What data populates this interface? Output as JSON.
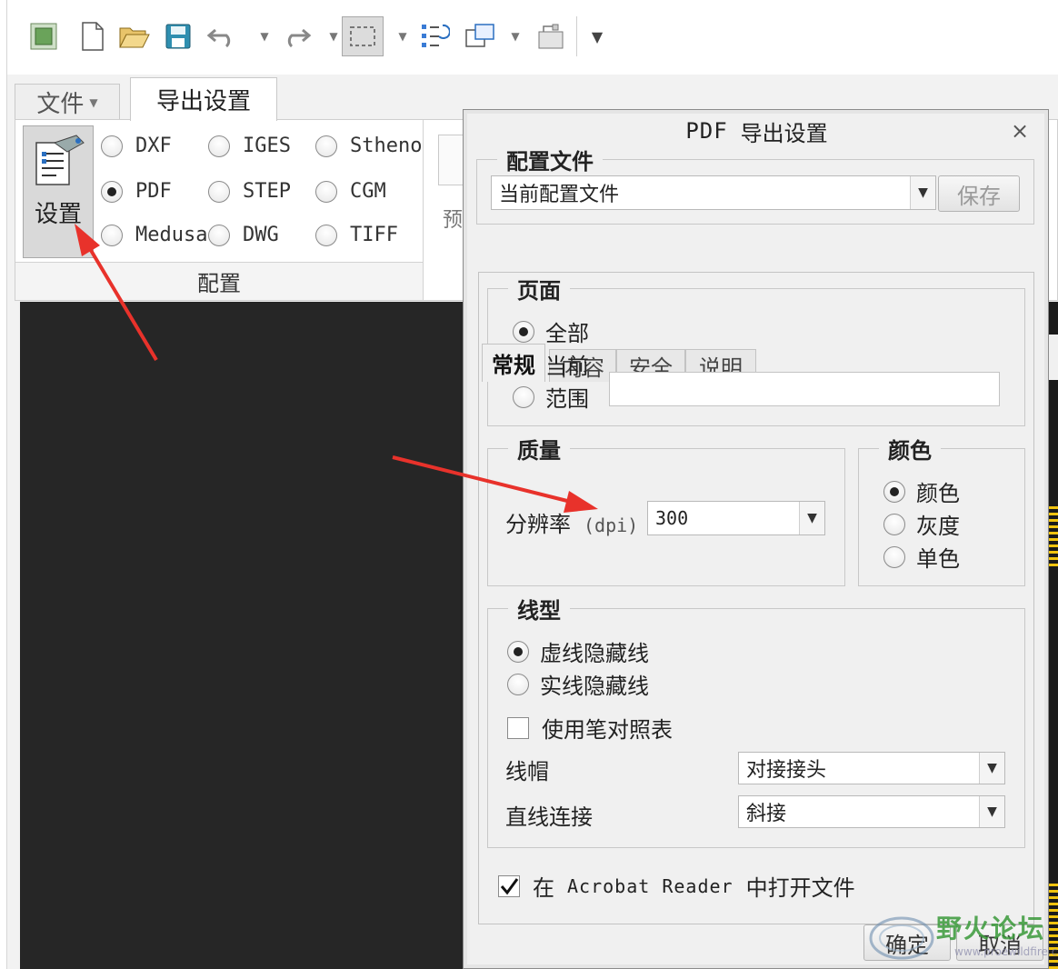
{
  "toolbar": {
    "icons": [
      "window-icon",
      "new-file-icon",
      "open-folder-icon",
      "save-icon",
      "undo-icon",
      "redo-icon",
      "select-box-icon",
      "regenerate-icon",
      "window-switch-icon",
      "close-window-icon",
      "more-icon"
    ]
  },
  "ribbon": {
    "tabs": [
      {
        "label": "文件",
        "state": "normal"
      },
      {
        "label": "导出设置",
        "state": "active"
      }
    ],
    "settings_label": "设置",
    "formats": [
      {
        "label": "DXF",
        "selected": false
      },
      {
        "label": "IGES",
        "selected": false
      },
      {
        "label": "Stheno",
        "selected": false
      },
      {
        "label": "PDF",
        "selected": true
      },
      {
        "label": "STEP",
        "selected": false
      },
      {
        "label": "CGM",
        "selected": false
      },
      {
        "label": "Medusa",
        "selected": false
      },
      {
        "label": "DWG",
        "selected": false
      },
      {
        "label": "TIFF",
        "selected": false
      }
    ],
    "group_label": "配置",
    "preview_fragment": "预"
  },
  "dialog": {
    "title_prefix": "PDF",
    "title": "导出设置",
    "close": "×",
    "profile": {
      "group_title": "配置文件",
      "value": "当前配置文件",
      "save_label": "保存"
    },
    "tabs": [
      {
        "label": "常规",
        "active": true
      },
      {
        "label": "内容",
        "active": false
      },
      {
        "label": "安全",
        "active": false
      },
      {
        "label": "说明",
        "active": false
      }
    ],
    "pages": {
      "group_title": "页面",
      "options": [
        {
          "label": "全部",
          "selected": true
        },
        {
          "label": "当前",
          "selected": false
        },
        {
          "label": "范围",
          "selected": false
        }
      ],
      "range_value": ""
    },
    "quality": {
      "group_title": "质量",
      "resolution_label": "分辨率",
      "unit": "(dpi)",
      "dpi_value": "300"
    },
    "color": {
      "group_title": "颜色",
      "options": [
        {
          "label": "颜色",
          "selected": true
        },
        {
          "label": "灰度",
          "selected": false
        },
        {
          "label": "单色",
          "selected": false
        }
      ]
    },
    "linetype": {
      "group_title": "线型",
      "options": [
        {
          "label": "虚线隐藏线",
          "selected": true
        },
        {
          "label": "实线隐藏线",
          "selected": false
        }
      ],
      "pen_table_label": "使用笔对照表",
      "pen_table_checked": false,
      "cap_label": "线帽",
      "cap_value": "对接接头",
      "join_label": "直线连接",
      "join_value": "斜接"
    },
    "open_reader": {
      "checked": true,
      "prefix": "在",
      "app": "Acrobat Reader",
      "suffix": "中打开文件"
    },
    "ok_label": "确定",
    "cancel_label": "取消"
  },
  "watermark": {
    "text": "野火论坛",
    "url": "www.proewildfire.cn"
  },
  "colors": {
    "accent_arrow": "#e8322b",
    "canvas": "#262626",
    "dialog_bg": "#f0f0f0"
  }
}
